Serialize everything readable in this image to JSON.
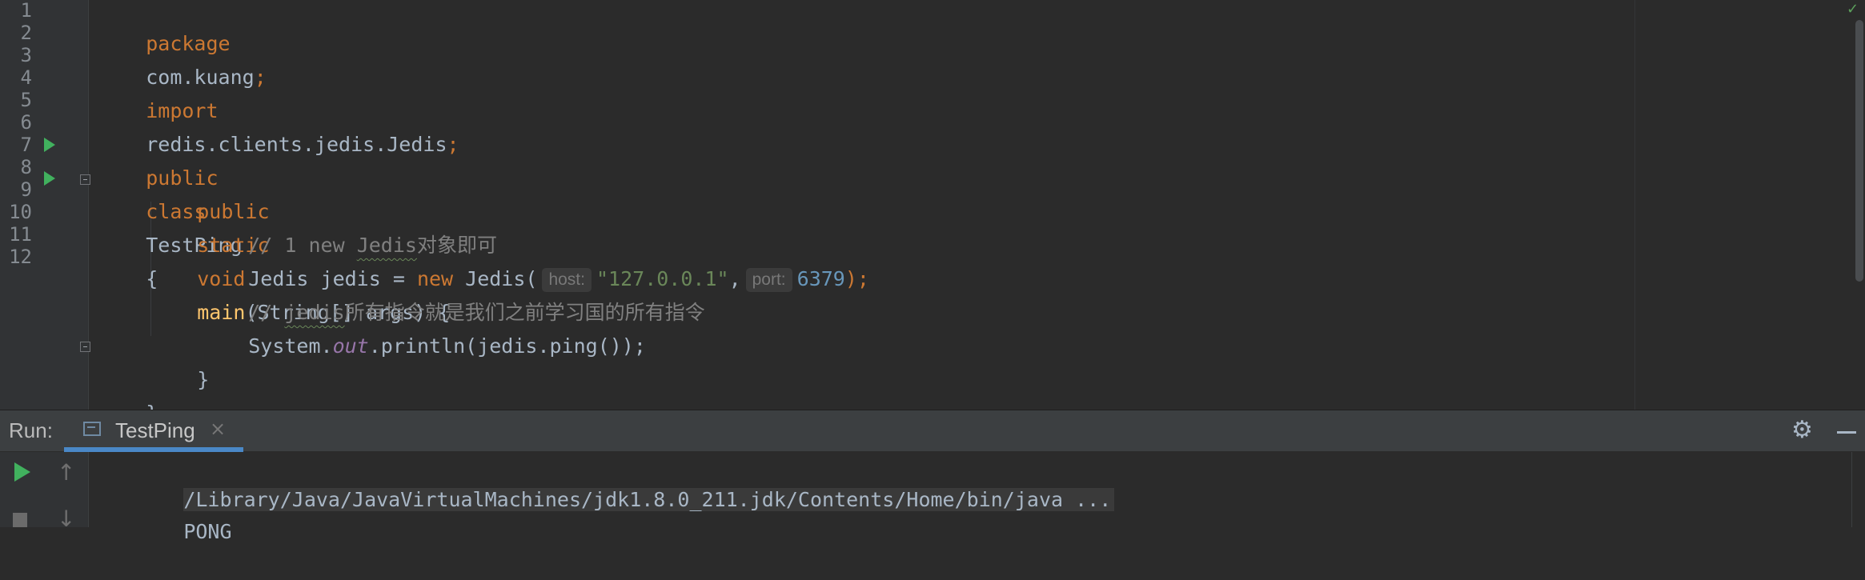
{
  "editor": {
    "line_numbers": [
      "1",
      "2",
      "3",
      "4",
      "5",
      "6",
      "7",
      "8",
      "9",
      "10",
      "11",
      "12"
    ],
    "lines": {
      "line1": {
        "kw": "package",
        "text": "com.kuang",
        "semi": ";"
      },
      "line3": {
        "kw": "import",
        "text": "redis.clients.jedis.Jedis",
        "semi": ";"
      },
      "line5": {
        "kw1": "public",
        "kw2": "class",
        "class_name": "TestPing",
        "brace": "{"
      },
      "line6": {
        "kw1": "public",
        "kw2": "static",
        "kw3": "void",
        "method": "main",
        "params": "(String[] args) {"
      },
      "line7": {
        "comment_prefix": "// 1 new ",
        "squiggle": "Jedis",
        "comment_suffix": "对象即可"
      },
      "line8": {
        "type": "Jedis jedis = ",
        "kw": "new",
        "ctor": " Jedis(",
        "host_hint": "host:",
        "host_value": "\"127.0.0.1\"",
        "comma": ",",
        "port_hint": "port:",
        "port_value": "6379",
        "end": ");"
      },
      "line9": {
        "comment_prefix": "// ",
        "squiggle": "jedis",
        "comment_suffix": "所有指令就是我们之前学习国的所有指令"
      },
      "line10": {
        "prefix": "System.",
        "field": "out",
        "suffix": ".println(jedis.ping());"
      },
      "line11": {
        "text": "}"
      },
      "line12": {
        "text": "}"
      }
    }
  },
  "run_panel": {
    "label": "Run:",
    "tab_label": "TestPing",
    "tab_close": "×",
    "console": {
      "command": "/Library/Java/JavaVirtualMachines/jdk1.8.0_211.jdk/Contents/Home/bin/java ...",
      "output": "PONG"
    },
    "icons": {
      "gear": "⚙",
      "up": "↑",
      "down": "↓",
      "check": "✓"
    }
  }
}
